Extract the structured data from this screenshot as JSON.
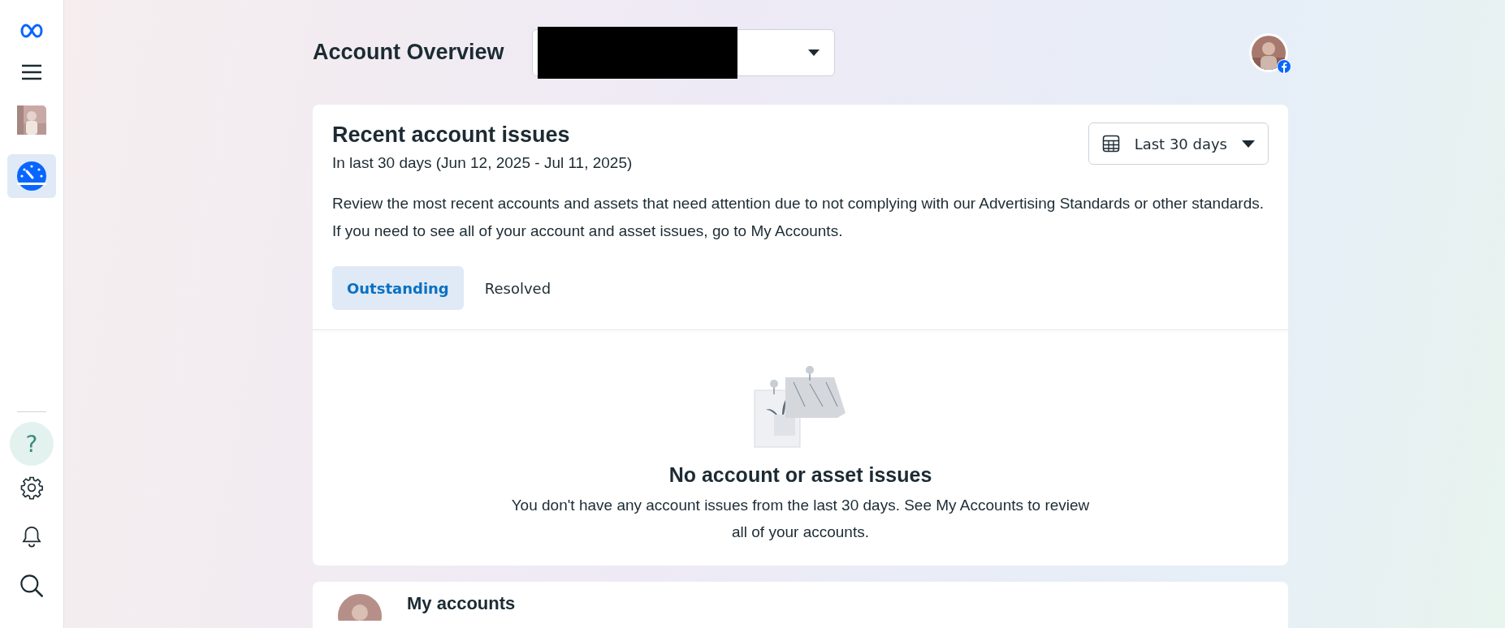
{
  "sidebar": {
    "items": [
      {
        "kind": "logo",
        "selected": false
      },
      {
        "kind": "menu",
        "selected": false
      },
      {
        "kind": "avatar",
        "selected": false
      },
      {
        "kind": "dashboard",
        "selected": true
      }
    ],
    "bottom_items": [
      {
        "kind": "help",
        "label": "?"
      },
      {
        "kind": "settings"
      },
      {
        "kind": "notifications"
      },
      {
        "kind": "search"
      }
    ]
  },
  "header": {
    "title": "Account Overview",
    "account_selector": {
      "redacted": true
    }
  },
  "issues_card": {
    "title": "Recent account issues",
    "subtitle": "In last 30 days (Jun 12, 2025 - Jul 11, 2025)",
    "date_range": "Last 30 days",
    "description": "Review the most recent accounts and assets that need attention due to not complying with our Advertising Standards or other standards. If you need to see all of your account and asset issues, go to My Accounts.",
    "tabs": [
      {
        "label": "Outstanding",
        "selected": true
      },
      {
        "label": "Resolved",
        "selected": false
      }
    ],
    "empty_state": {
      "title": "No account or asset issues",
      "text": "You don't have any account issues from the last 30 days. See My Accounts to review all of your accounts."
    }
  },
  "accounts_card": {
    "title": "My accounts"
  }
}
